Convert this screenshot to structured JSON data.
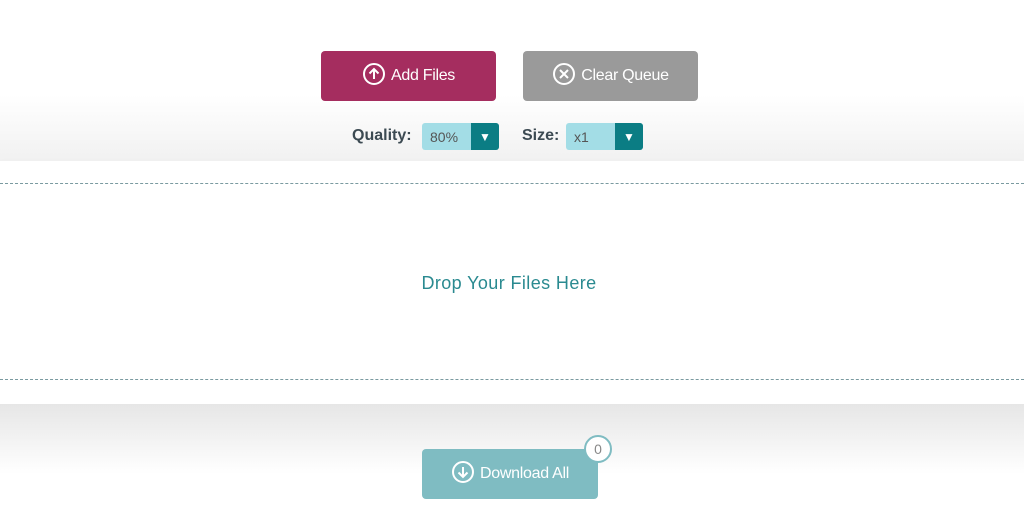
{
  "toolbar": {
    "add_files": "Add Files",
    "clear_queue": "Clear Queue"
  },
  "options": {
    "quality_label": "Quality:",
    "quality_value": "80%",
    "size_label": "Size:",
    "size_value": "x1",
    "dropdown_arrow": "▼"
  },
  "dropzone": {
    "text": "Drop Your Files Here"
  },
  "download": {
    "label": "Download All",
    "count": "0"
  },
  "colors": {
    "add": "#a52d5f",
    "clear": "#9a9a9a",
    "download": "#7fbcc2",
    "accent": "#0b7d84"
  }
}
